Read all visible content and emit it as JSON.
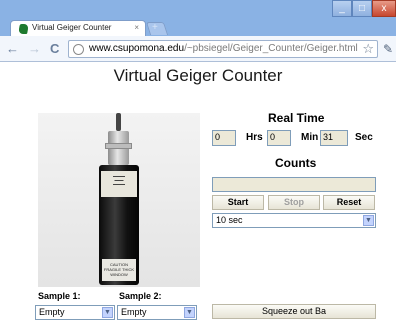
{
  "browser": {
    "tab_title": "Virtual Geiger Counter",
    "tab_close": "×",
    "url_host": "www.csupomona.edu",
    "url_path": "/~pbsiegel/Geiger_Counter/Geiger.html",
    "win_min": "_",
    "win_max": "□",
    "win_close": "x"
  },
  "page": {
    "title": "Virtual Geiger Counter",
    "real_time_label": "Real Time",
    "hrs_value": "0",
    "hrs_label": "Hrs",
    "min_value": "0",
    "min_label": "Min",
    "sec_value": "31",
    "sec_label": "Sec",
    "counts_label": "Counts",
    "counts_value": "",
    "start_label": "Start",
    "stop_label": "Stop",
    "reset_label": "Reset",
    "interval_selected": "10 sec",
    "sample1_label": "Sample 1:",
    "sample1_selected": "Empty",
    "sample2_label": "Sample 2:",
    "sample2_selected": "Empty",
    "squeeze_label": "Squeeze out Ba",
    "probe_caution": "CAUTION FRAGILE THICK WINDOW"
  }
}
